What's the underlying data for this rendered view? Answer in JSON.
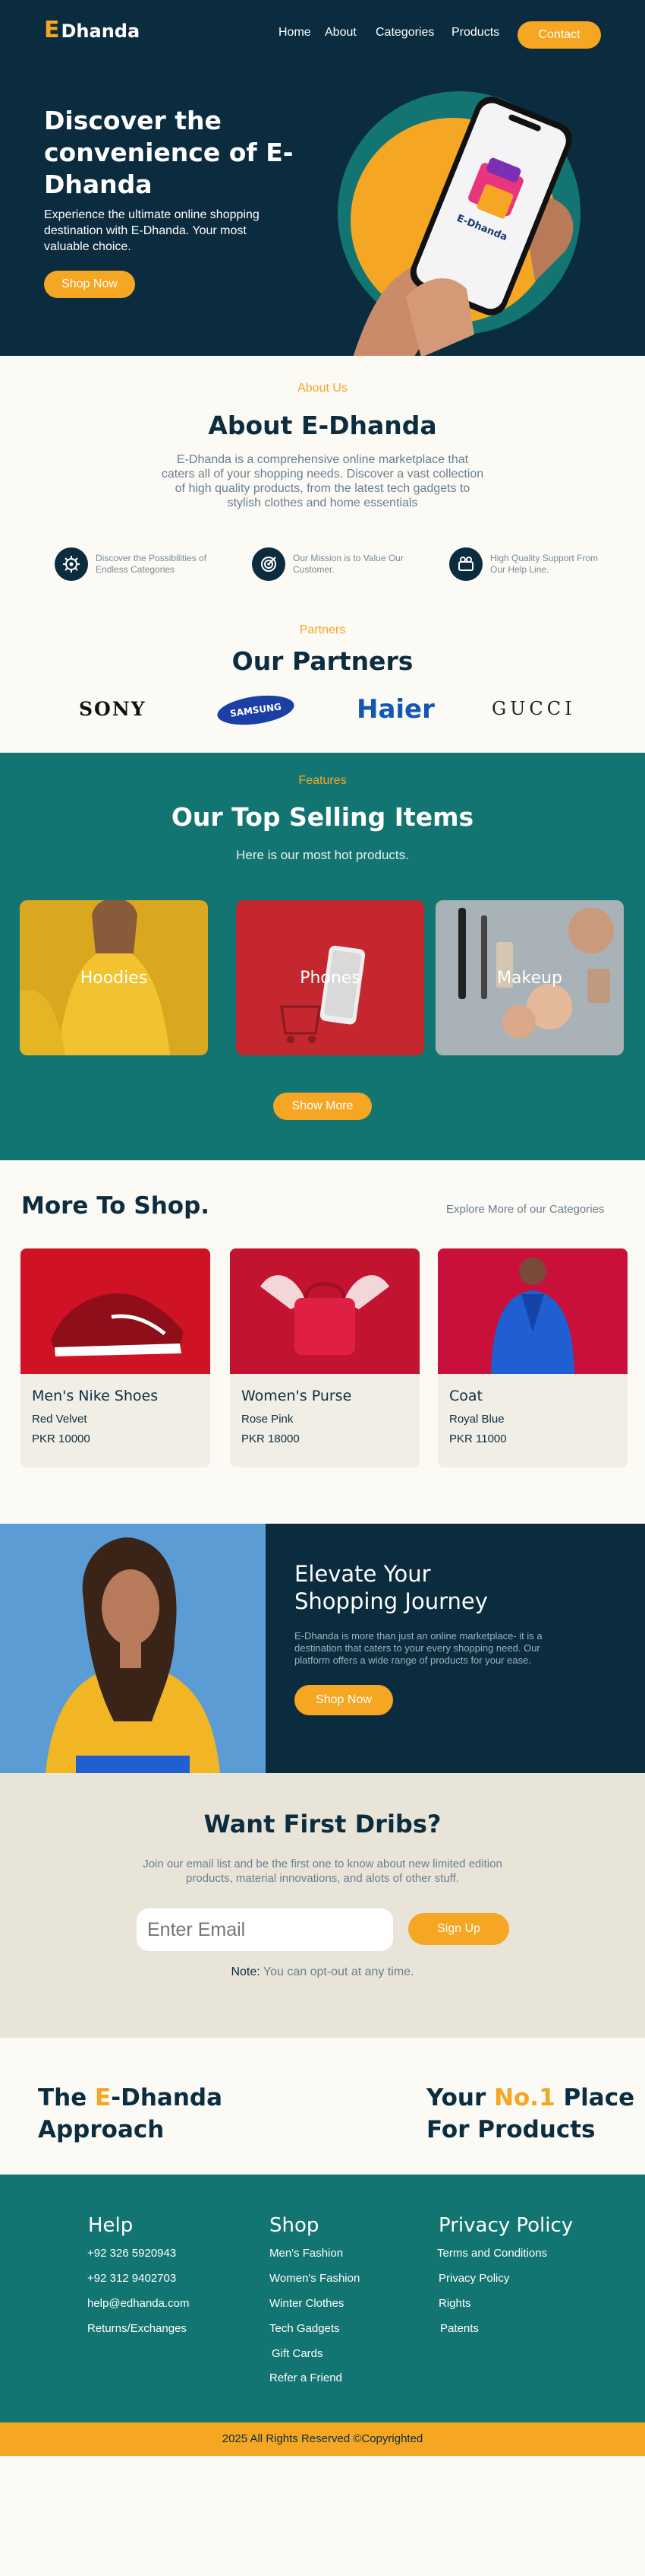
{
  "header": {
    "logo_letter": "E",
    "logo_name": "Dhanda",
    "nav": [
      "Home",
      "About",
      "Categories",
      "Products"
    ],
    "cta": "Contact"
  },
  "hero": {
    "title": "Discover the convenience of E-Dhanda",
    "subtitle": "Experience the ultimate online shopping destination with E-Dhanda. Your most valuable choice.",
    "button": "Shop Now",
    "phone_brand": "E-Dhanda"
  },
  "about": {
    "kicker": "About Us",
    "title": "About E-Dhanda",
    "text": "E-Dhanda is a comprehensive online marketplace that caters all of your shopping needs. Discover a vast collection of high quality products, from the latest tech gadgets to stylish clothes and home essentials",
    "features": [
      {
        "icon": "gear-icon",
        "text": "Discover the Possibilities of Endless Categories"
      },
      {
        "icon": "target-icon",
        "text": "Our Mission is to Value Our Customer."
      },
      {
        "icon": "support-icon",
        "text": "High Quality Support From Our Help Line."
      }
    ]
  },
  "partners": {
    "kicker": "Partners",
    "title": "Our Partners",
    "logos": [
      "SONY",
      "SAMSUNG",
      "Haier",
      "GUCCI"
    ]
  },
  "features": {
    "kicker": "Features",
    "title": "Our Top Selling Items",
    "subtitle": "Here is our most hot products.",
    "items": [
      "Hoodies",
      "Phones",
      "Makeup"
    ],
    "button": "Show More"
  },
  "more_to_shop": {
    "title": "More To Shop.",
    "link": "Explore More of our Categories",
    "products": [
      {
        "name": "Men's Nike Shoes",
        "variant": "Red Velvet",
        "price": "PKR 10000"
      },
      {
        "name": "Women's Purse",
        "variant": "Rose Pink",
        "price": "PKR 18000"
      },
      {
        "name": "Coat",
        "variant": "Royal Blue",
        "price": "PKR 11000"
      }
    ]
  },
  "elevate": {
    "title": "Elevate Your Shopping Journey",
    "text": "E-Dhanda is more than just an online marketplace- it is a destination that caters to your every shopping need. Our platform offers a wide range of products for your ease.",
    "button": "Shop Now"
  },
  "newsletter": {
    "title": "Want First Dribs?",
    "text": "Join our email list and be the first one to know about new limited edition products, material innovations, and alots of other stuff.",
    "placeholder": "Enter Email",
    "button": "Sign Up",
    "note_label": "Note:",
    "note_text": "You can opt-out at any time."
  },
  "approach": {
    "left_pre": "The ",
    "left_accent": "E",
    "left_post": "-Dhanda",
    "left_line2": "Approach",
    "right_pre": "Your ",
    "right_accent": "No.1",
    "right_post": " Place",
    "right_line2": "For Products"
  },
  "footer": {
    "help_title": "Help",
    "help_items": [
      "+92 326 5920943",
      "+92 312 9402703",
      "help@edhanda.com",
      "Returns/Exchanges"
    ],
    "shop_title": "Shop",
    "shop_items": [
      "Men's Fashion",
      "Women's Fashion",
      "Winter Clothes",
      "Tech Gadgets",
      "Gift Cards",
      "Refer a Friend"
    ],
    "policy_title": "Privacy Policy",
    "policy_items": [
      "Terms and Conditions",
      "Privacy Policy",
      "Rights",
      "Patents"
    ],
    "copyright": "2025 All Rights Reserved ©Copyrighted"
  },
  "colors": {
    "navy": "#0b2b3e",
    "accent": "#f5a623",
    "teal": "#137571",
    "cream": "#fbfaf5"
  }
}
